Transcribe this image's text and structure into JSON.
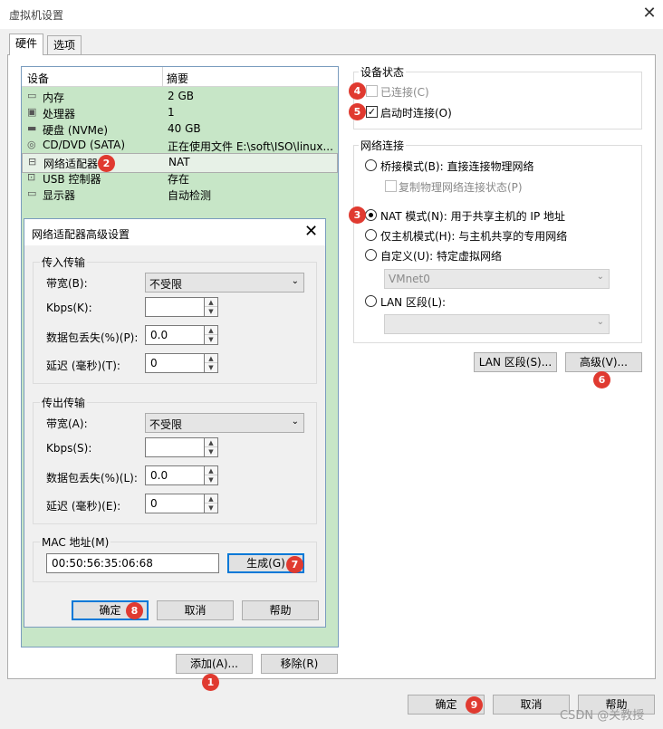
{
  "window": {
    "title": "虚拟机设置",
    "close_glyph": "✕"
  },
  "tabs": [
    {
      "label": "硬件"
    },
    {
      "label": "选项"
    }
  ],
  "device_list": {
    "headers": {
      "device": "设备",
      "summary": "摘要"
    },
    "rows": [
      {
        "name": "内存",
        "summary": "2 GB",
        "icon": "memory-icon"
      },
      {
        "name": "处理器",
        "summary": "1",
        "icon": "cpu-icon"
      },
      {
        "name": "硬盘 (NVMe)",
        "summary": "40 GB",
        "icon": "hard-disk-icon"
      },
      {
        "name": "CD/DVD (SATA)",
        "summary": "正在使用文件 E:\\soft\\ISO\\linux...",
        "icon": "cd-dvd-icon"
      },
      {
        "name": "网络适配器",
        "summary": "NAT",
        "icon": "network-adapter-icon",
        "selected": true
      },
      {
        "name": "USB 控制器",
        "summary": "存在",
        "icon": "usb-icon"
      },
      {
        "name": "显示器",
        "summary": "自动检测",
        "icon": "monitor-icon"
      }
    ]
  },
  "device_buttons": {
    "add": "添加(A)...",
    "remove": "移除(R)"
  },
  "device_status": {
    "group_label": "设备状态",
    "connected": {
      "label": "已连接(C)",
      "checked": false,
      "disabled": true
    },
    "connect_at_power_on": {
      "label": "启动时连接(O)",
      "checked": true
    }
  },
  "network_connection": {
    "group_label": "网络连接",
    "bridged": {
      "label": "桥接模式(B): 直接连接物理网络",
      "selected": false
    },
    "replicate": {
      "label": "复制物理网络连接状态(P)",
      "checked": false,
      "disabled": true
    },
    "nat": {
      "label": "NAT 模式(N): 用于共享主机的 IP 地址",
      "selected": true
    },
    "host_only": {
      "label": "仅主机模式(H): 与主机共享的专用网络",
      "selected": false
    },
    "custom": {
      "label": "自定义(U): 特定虚拟网络",
      "selected": false
    },
    "custom_dropdown": "VMnet0",
    "lan_segment": {
      "label": "LAN 区段(L):",
      "selected": false
    },
    "lan_dropdown": ""
  },
  "network_buttons": {
    "lan_segments": "LAN 区段(S)...",
    "advanced": "高级(V)..."
  },
  "footer": {
    "ok": "确定",
    "cancel": "取消",
    "help": "帮助"
  },
  "advanced_dialog": {
    "title": "网络适配器高级设置",
    "close_glyph": "✕",
    "incoming": {
      "group_label": "传入传输",
      "bandwidth_label": "带宽(B):",
      "bandwidth_value": "不受限",
      "kbps_label": "Kbps(K):",
      "kbps_value": "",
      "loss_label": "数据包丢失(%)(P):",
      "loss_value": "0.0",
      "latency_label": "延迟 (毫秒)(T):",
      "latency_value": "0"
    },
    "outgoing": {
      "group_label": "传出传输",
      "bandwidth_label": "带宽(A):",
      "bandwidth_value": "不受限",
      "kbps_label": "Kbps(S):",
      "kbps_value": "",
      "loss_label": "数据包丢失(%)(L):",
      "loss_value": "0.0",
      "latency_label": "延迟 (毫秒)(E):",
      "latency_value": "0"
    },
    "mac": {
      "group_label": "MAC 地址(M)",
      "value": "00:50:56:35:06:68",
      "generate": "生成(G)"
    },
    "buttons": {
      "ok": "确定",
      "cancel": "取消",
      "help": "帮助"
    }
  },
  "step_badges": [
    "1",
    "2",
    "3",
    "4",
    "5",
    "6",
    "7",
    "8",
    "9"
  ],
  "watermark": "CSDN @关教授",
  "colors": {
    "badge": "#e03a30",
    "device_list_bg": "#c7e6c7",
    "default_button_border": "#0078d7"
  }
}
